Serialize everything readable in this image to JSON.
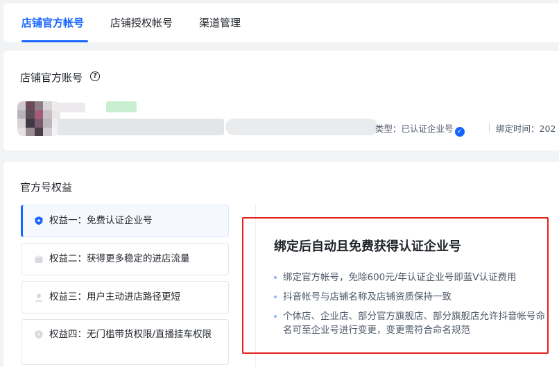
{
  "tabs": [
    {
      "label": "店铺官方帐号",
      "active": true
    },
    {
      "label": "店铺授权帐号",
      "active": false
    },
    {
      "label": "渠道管理",
      "active": false
    }
  ],
  "account": {
    "title": "店铺官方账号",
    "help_icon": "question-circle-icon",
    "type_label": "类型：",
    "type_value": "已认证企业号",
    "verified_icon": "check-badge-icon",
    "bind_time_label": "绑定时间：",
    "bind_time_value": "202"
  },
  "benefits": {
    "title": "官方号权益",
    "items": [
      {
        "label": "权益一：免费认证企业号",
        "icon": "shield-badge-icon",
        "active": true
      },
      {
        "label": "权益二：获得更多稳定的进店流量",
        "icon": "traffic-icon",
        "active": false
      },
      {
        "label": "权益三：用户主动进店路径更短",
        "icon": "user-icon",
        "active": false
      },
      {
        "label": "权益四：无门槛带货权限/直播挂车权限",
        "icon": "shield-icon",
        "active": false
      }
    ]
  },
  "detail": {
    "title": "绑定后自动且免费获得认证企业号",
    "bullets": [
      "绑定官方帐号，免除600元/年认证企业号即蓝V认证费用",
      "抖音帐号与店铺名称及店铺资质保持一致",
      "个体店、企业店、部分官方旗舰店、部分旗舰店允许抖音帐号命名可至企业号进行变更，变更需符合命名规范"
    ]
  },
  "colors": {
    "accent": "#1664ff",
    "highlight_border": "#e3201d"
  }
}
